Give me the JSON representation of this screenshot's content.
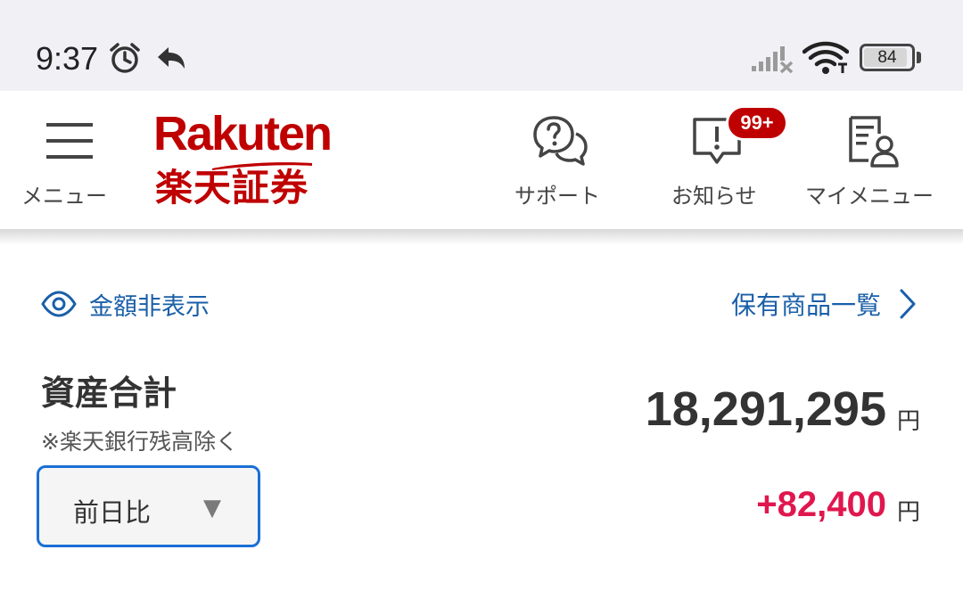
{
  "status_bar": {
    "time": "9:37",
    "icons": [
      "alarm-icon",
      "reply-arrow-icon",
      "signal-off-icon",
      "wifi-icon",
      "battery-icon"
    ],
    "battery_level": "84"
  },
  "header": {
    "menu_label": "メニュー",
    "logo_text": "Rakuten",
    "logo_subtext": "楽天証券",
    "support_label": "サポート",
    "notifications_label": "お知らせ",
    "notifications_badge": "99+",
    "my_menu_label": "マイメニュー",
    "brand_color": "#bf0000"
  },
  "content": {
    "hide_amount_label": "金額非表示",
    "holdings_link_label": "保有商品一覧",
    "assets_title": "資産合計",
    "assets_note": "※楽天銀行残高除く",
    "total_amount": "18,291,295",
    "currency_unit": "円",
    "compare_select_value": "前日比",
    "change_amount": "+82,400",
    "link_color": "#1a5fa8",
    "positive_color": "#e0174e"
  }
}
